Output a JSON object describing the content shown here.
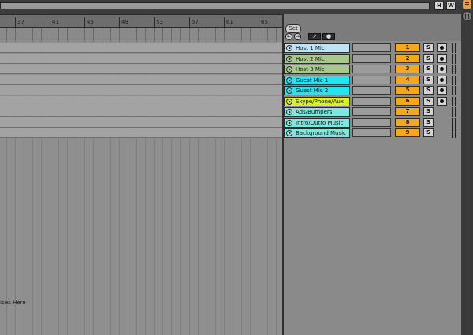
{
  "top_bar": {
    "h_label": "H",
    "w_label": "W"
  },
  "ruler": {
    "ticks": [
      "37",
      "41",
      "45",
      "49",
      "53",
      "57",
      "61",
      "65"
    ]
  },
  "mixer": {
    "set_label": "Set",
    "expand_icon": "expand-arrows-icon",
    "lock_icon": "lock-icon"
  },
  "tracks": [
    {
      "name": "Host 1 Mic",
      "number": "1",
      "solo": "S",
      "color": "#bfe3f5",
      "has_arm": true
    },
    {
      "name": "Host 2 Mic",
      "number": "2",
      "solo": "S",
      "color": "#a8c98c",
      "has_arm": true
    },
    {
      "name": "Host 3 Mic",
      "number": "3",
      "solo": "S",
      "color": "#a8c98c",
      "has_arm": true
    },
    {
      "name": "Guest Mic 1",
      "number": "4",
      "solo": "S",
      "color": "#1fe6f0",
      "has_arm": true
    },
    {
      "name": "Guest Mic 2",
      "number": "5",
      "solo": "S",
      "color": "#1fe6f0",
      "has_arm": true
    },
    {
      "name": "Skype/Phone/Aux",
      "number": "6",
      "solo": "S",
      "color": "#d8f21c",
      "has_arm": true
    },
    {
      "name": "Ads/Bumpers",
      "number": "7",
      "solo": "S",
      "color": "#7de8e0",
      "has_arm": false
    },
    {
      "name": "Intro/Outro Music",
      "number": "8",
      "solo": "S",
      "color": "#7de8e0",
      "has_arm": false
    },
    {
      "name": "Background Music",
      "number": "9",
      "solo": "S",
      "color": "#7de8e0",
      "has_arm": false
    }
  ],
  "arrangement": {
    "drop_text": "vices Here"
  },
  "colors": {
    "track_number_bg": "#f4a91d",
    "accent_orange": "#e2a24b"
  }
}
